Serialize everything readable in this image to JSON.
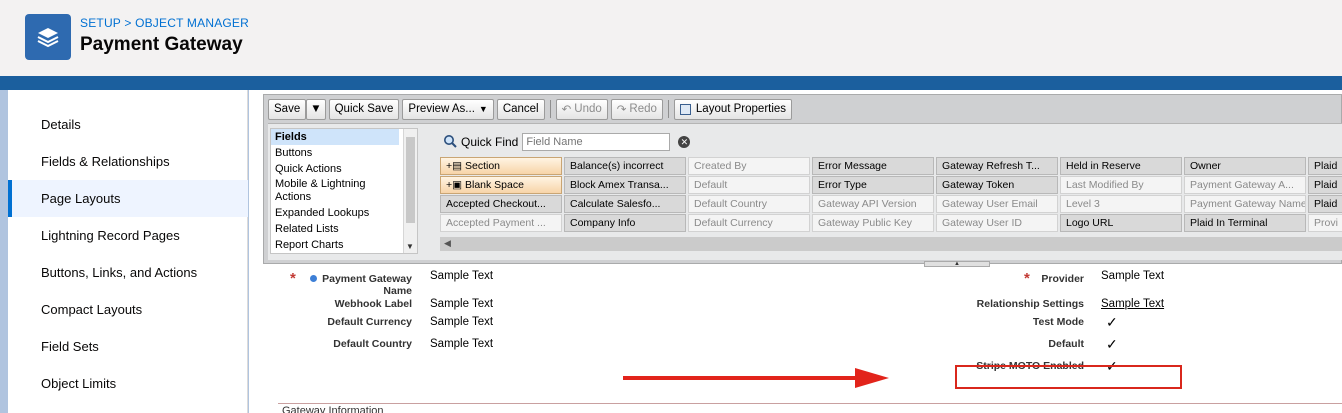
{
  "header": {
    "breadcrumb": "SETUP > OBJECT MANAGER",
    "title": "Payment Gateway"
  },
  "sidebar": {
    "items": [
      {
        "label": "Details"
      },
      {
        "label": "Fields & Relationships"
      },
      {
        "label": "Page Layouts"
      },
      {
        "label": "Lightning Record Pages"
      },
      {
        "label": "Buttons, Links, and Actions"
      },
      {
        "label": "Compact Layouts"
      },
      {
        "label": "Field Sets"
      },
      {
        "label": "Object Limits"
      }
    ],
    "active": "Page Layouts"
  },
  "toolbar": {
    "save": "Save",
    "quick_save": "Quick Save",
    "preview_as": "Preview As...",
    "cancel": "Cancel",
    "undo": "Undo",
    "redo": "Redo",
    "layout_properties": "Layout Properties"
  },
  "palette": {
    "categories": [
      "Fields",
      "Buttons",
      "Quick Actions",
      "Mobile & Lightning Actions",
      "Expanded Lookups",
      "Related Lists",
      "Report Charts"
    ],
    "quick_find_label": "Quick Find",
    "quick_find_placeholder": "Field Name",
    "fields": [
      [
        "Section",
        "Balance(s) incorrect",
        "Created By",
        "Error Message",
        "Gateway Refresh T...",
        "Held in Reserve",
        "Owner",
        "Plaid"
      ],
      [
        "Blank Space",
        "Block Amex Transa...",
        "Default",
        "Error Type",
        "Gateway Token",
        "Last Modified By",
        "Payment Gateway A...",
        "Plaid"
      ],
      [
        "Accepted Checkout...",
        "Calculate Salesfo...",
        "Default Country",
        "Gateway API Version",
        "Gateway User Email",
        "Level 3",
        "Payment Gateway Name",
        "Plaid"
      ],
      [
        "Accepted Payment ...",
        "Company Info",
        "Default Currency",
        "Gateway Public Key",
        "Gateway User ID",
        "Logo URL",
        "Plaid In Terminal",
        "Provi"
      ]
    ]
  },
  "layout": {
    "left": [
      {
        "label": "Payment Gateway Name",
        "value": "Sample Text"
      },
      {
        "label": "Webhook Label",
        "value": "Sample Text"
      },
      {
        "label": "Default Currency",
        "value": "Sample Text"
      },
      {
        "label": "Default Country",
        "value": "Sample Text"
      }
    ],
    "right": [
      {
        "label": "Provider",
        "value": "Sample Text"
      },
      {
        "label": "Relationship Settings",
        "value": "Sample Text"
      },
      {
        "label": "Test Mode",
        "value": "✓"
      },
      {
        "label": "Default",
        "value": "✓"
      },
      {
        "label": "Stripe MOTO Enabled",
        "value": "✓"
      }
    ],
    "next_section": "Gateway Information"
  },
  "colors": {
    "brand": "#1b5f9e",
    "accent": "#0070d2",
    "highlight": "#d9271c"
  }
}
